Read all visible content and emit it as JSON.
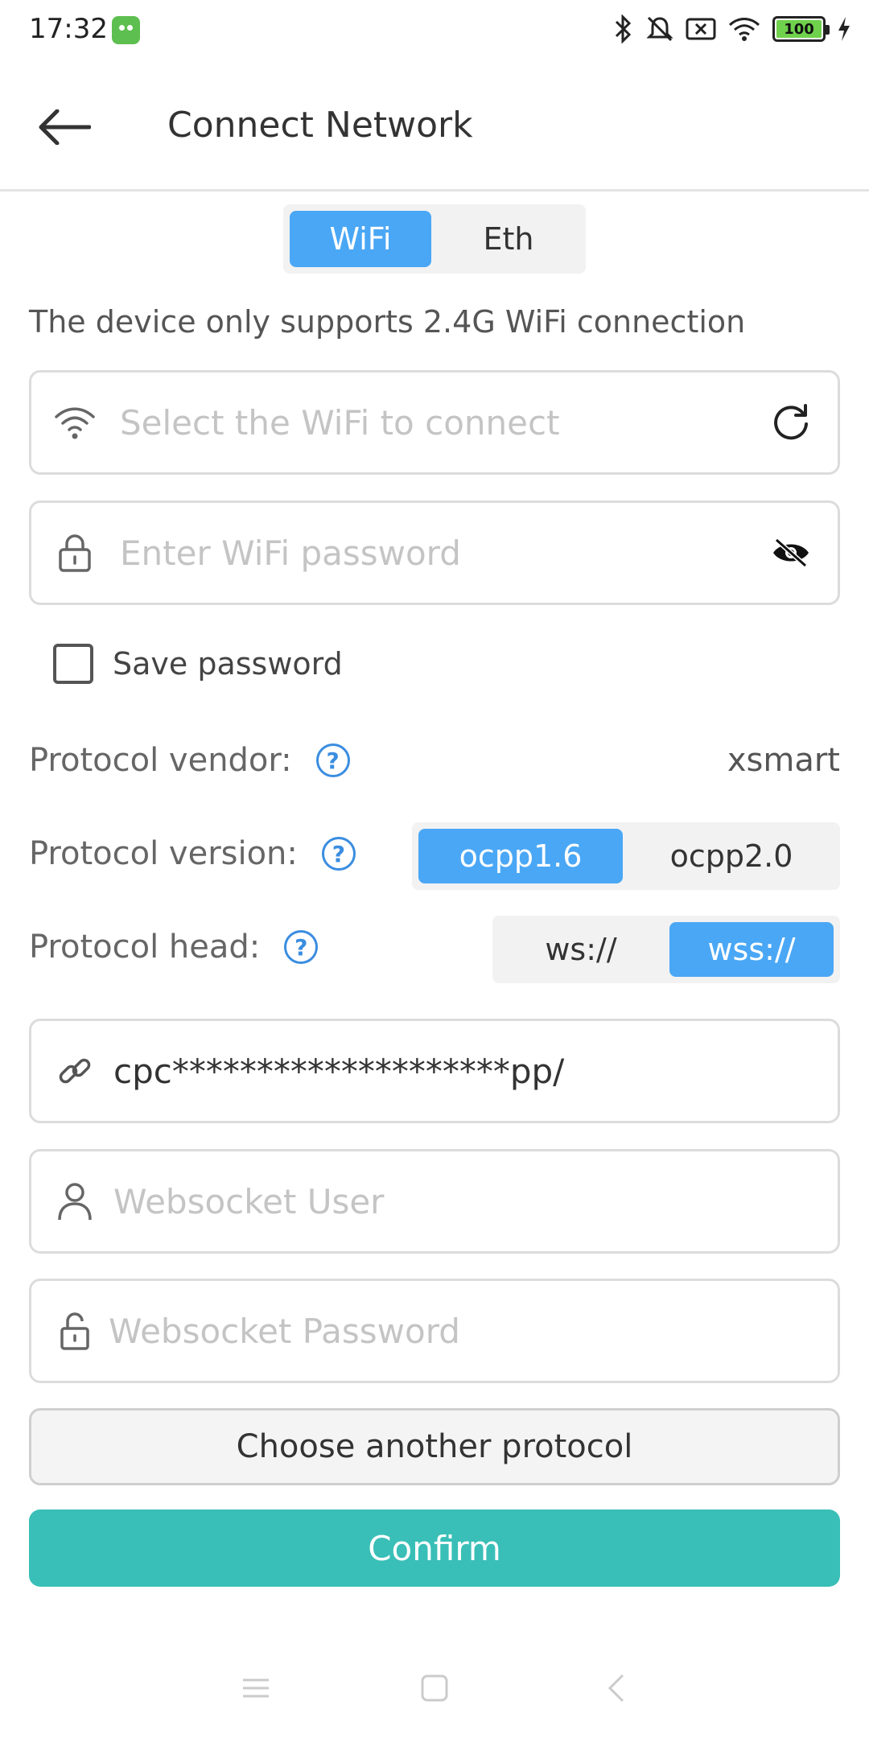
{
  "status_bar": {
    "time": "17:32",
    "battery": "100",
    "icons": [
      "app-icon",
      "bluetooth-icon",
      "silent-icon",
      "sim-icon",
      "wifi-signal-icon",
      "battery-icon",
      "charging-icon"
    ]
  },
  "header": {
    "title": "Connect Network"
  },
  "network_tabs": {
    "wifi": "WiFi",
    "eth": "Eth",
    "selected": "WiFi"
  },
  "hint": "The device only supports 2.4G WiFi connection",
  "wifi_select": {
    "placeholder": "Select the WiFi to connect"
  },
  "wifi_password": {
    "placeholder": "Enter WiFi password"
  },
  "save_password": {
    "label": "Save password",
    "checked": false
  },
  "protocol": {
    "vendor_label": "Protocol vendor:",
    "vendor_value": "xsmart",
    "version_label": "Protocol version:",
    "version_options": [
      "ocpp1.6",
      "ocpp2.0"
    ],
    "version_selected": "ocpp1.6",
    "head_label": "Protocol head:",
    "head_options": [
      "ws://",
      "wss://"
    ],
    "head_selected": "wss://",
    "help_glyph": "?"
  },
  "server_url": {
    "value": "cpc********************pp/"
  },
  "websocket_user": {
    "placeholder": "Websocket User"
  },
  "websocket_password": {
    "placeholder": "Websocket Password"
  },
  "buttons": {
    "choose_protocol": "Choose another protocol",
    "confirm": "Confirm"
  },
  "colors": {
    "accent_blue": "#4aa7f5",
    "confirm_teal": "#39bfb7",
    "help_blue": "#3a8de0"
  }
}
